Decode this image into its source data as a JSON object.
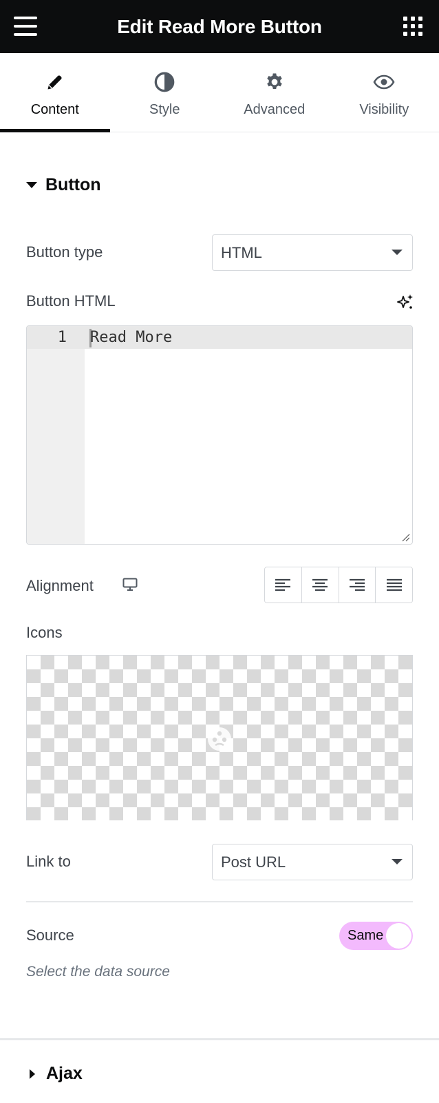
{
  "header": {
    "title": "Edit Read More Button"
  },
  "tabs": [
    {
      "label": "Content",
      "icon": "pencil-icon",
      "active": true
    },
    {
      "label": "Style",
      "icon": "half-circle-icon",
      "active": false
    },
    {
      "label": "Advanced",
      "icon": "gear-icon",
      "active": false
    },
    {
      "label": "Visibility",
      "icon": "eye-icon",
      "active": false
    }
  ],
  "section_button": {
    "title": "Button",
    "button_type": {
      "label": "Button type",
      "value": "HTML"
    },
    "button_html": {
      "label": "Button HTML",
      "line_number": "1",
      "code": "Read More"
    },
    "alignment": {
      "label": "Alignment",
      "device_icon": "desktop-icon",
      "options": [
        "left",
        "center",
        "right",
        "justify"
      ]
    },
    "icons": {
      "label": "Icons"
    },
    "link_to": {
      "label": "Link to",
      "value": "Post URL"
    },
    "source": {
      "label": "Source",
      "toggle_text": "Same",
      "help": "Select the data source"
    }
  },
  "section_ajax": {
    "title": "Ajax"
  },
  "colors": {
    "header_bg": "#0c0d0e",
    "toggle_bg": "#f3bafd",
    "text": "#3f444b"
  }
}
